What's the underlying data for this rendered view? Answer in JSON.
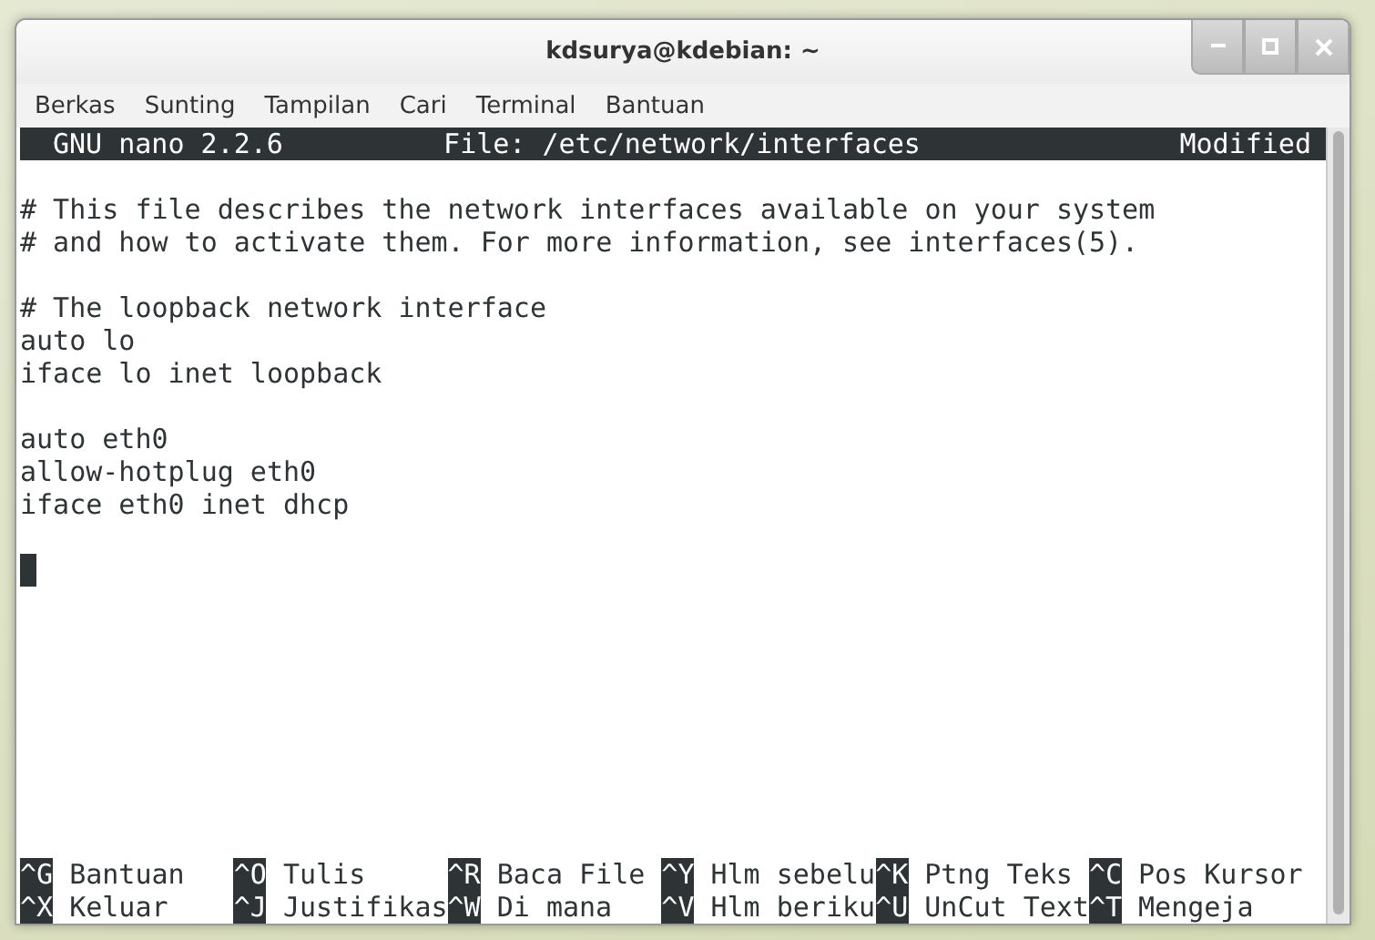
{
  "window": {
    "title": "kdsurya@kdebian: ~"
  },
  "menu": [
    "Berkas",
    "Sunting",
    "Tampilan",
    "Cari",
    "Terminal",
    "Bantuan"
  ],
  "nano": {
    "version": "GNU nano 2.2.6",
    "file": "File: /etc/network/interfaces",
    "status": "Modified",
    "blocks": [
      {
        "lines": [
          "# This file describes the network interfaces available on your system",
          "# and how to activate them. For more information, see interfaces(5)."
        ]
      },
      {
        "lines": [
          "# The loopback network interface",
          "auto lo",
          "iface lo inet loopback"
        ]
      },
      {
        "lines": [
          "auto eth0",
          "allow-hotplug eth0",
          "iface eth0 inet dhcp"
        ]
      }
    ],
    "cursor_visible": true,
    "shortcuts": [
      [
        {
          "key": "^G",
          "label": "Bantuan"
        },
        {
          "key": "^O",
          "label": "Tulis"
        },
        {
          "key": "^R",
          "label": "Baca File"
        },
        {
          "key": "^Y",
          "label": "Hlm sebelu"
        },
        {
          "key": "^K",
          "label": "Ptng Teks"
        },
        {
          "key": "^C",
          "label": "Pos Kursor"
        }
      ],
      [
        {
          "key": "^X",
          "label": "Keluar"
        },
        {
          "key": "^J",
          "label": "Justifikas"
        },
        {
          "key": "^W",
          "label": "Di mana"
        },
        {
          "key": "^V",
          "label": "Hlm beriku"
        },
        {
          "key": "^U",
          "label": "UnCut Text"
        },
        {
          "key": "^T",
          "label": "Mengeja"
        }
      ]
    ]
  }
}
